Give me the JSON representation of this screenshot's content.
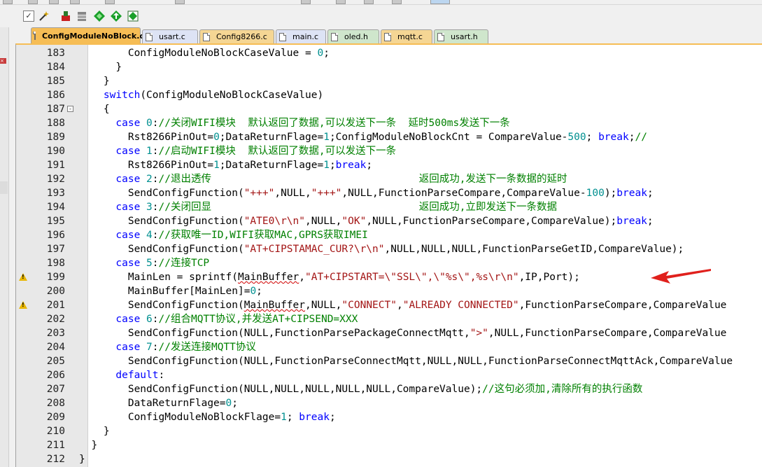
{
  "tabs": [
    {
      "label": "ConfigModuleNoBlock.c",
      "kind": "c",
      "active": true
    },
    {
      "label": "usart.c",
      "kind": "c2",
      "active": false
    },
    {
      "label": "Config8266.c",
      "kind": "c",
      "active": false
    },
    {
      "label": "main.c",
      "kind": "c2",
      "active": false
    },
    {
      "label": "oled.h",
      "kind": "h",
      "active": false
    },
    {
      "label": "mqtt.c",
      "kind": "c",
      "active": false
    },
    {
      "label": "usart.h",
      "kind": "h",
      "active": false
    }
  ],
  "editor": {
    "lines": [
      {
        "num": "183",
        "fold": "",
        "warn": false,
        "segs": [
          [
            "",
            "        ConfigModuleNoBlockCaseValue = "
          ],
          [
            "num",
            "0"
          ],
          [
            "",
            ";"
          ]
        ]
      },
      {
        "num": "184",
        "fold": "",
        "warn": false,
        "segs": [
          [
            "",
            "      }"
          ]
        ]
      },
      {
        "num": "185",
        "fold": "",
        "warn": false,
        "segs": [
          [
            "",
            "    }"
          ]
        ]
      },
      {
        "num": "186",
        "fold": "",
        "warn": false,
        "segs": [
          [
            "",
            "    "
          ],
          [
            "kw",
            "switch"
          ],
          [
            "",
            "(ConfigModuleNoBlockCaseValue)"
          ]
        ]
      },
      {
        "num": "187",
        "fold": "-",
        "warn": false,
        "segs": [
          [
            "",
            "    {"
          ]
        ]
      },
      {
        "num": "188",
        "fold": "",
        "warn": false,
        "segs": [
          [
            "",
            "      "
          ],
          [
            "kw",
            "case"
          ],
          [
            "",
            " "
          ],
          [
            "num",
            "0"
          ],
          [
            "",
            ":"
          ],
          [
            "cm",
            "//关闭WIFI模块  默认返回了数据,可以发送下一条  延时500ms发送下一条"
          ]
        ]
      },
      {
        "num": "189",
        "fold": "",
        "warn": false,
        "segs": [
          [
            "",
            "        Rst8266PinOut="
          ],
          [
            "num",
            "0"
          ],
          [
            "",
            ";DataReturnFlage="
          ],
          [
            "num",
            "1"
          ],
          [
            "",
            ";ConfigModuleNoBlockCnt = CompareValue-"
          ],
          [
            "num",
            "500"
          ],
          [
            "",
            "; "
          ],
          [
            "kw",
            "break"
          ],
          [
            "",
            ";"
          ],
          [
            "cm",
            "//"
          ]
        ]
      },
      {
        "num": "190",
        "fold": "",
        "warn": false,
        "segs": [
          [
            "",
            "      "
          ],
          [
            "kw",
            "case"
          ],
          [
            "",
            " "
          ],
          [
            "num",
            "1"
          ],
          [
            "",
            ":"
          ],
          [
            "cm",
            "//启动WIFI模块  默认返回了数据,可以发送下一条"
          ]
        ]
      },
      {
        "num": "191",
        "fold": "",
        "warn": false,
        "segs": [
          [
            "",
            "        Rst8266PinOut="
          ],
          [
            "num",
            "1"
          ],
          [
            "",
            ";DataReturnFlage="
          ],
          [
            "num",
            "1"
          ],
          [
            "",
            ";"
          ],
          [
            "kw",
            "break"
          ],
          [
            "",
            ";"
          ]
        ]
      },
      {
        "num": "192",
        "fold": "",
        "warn": false,
        "segs": [
          [
            "",
            "      "
          ],
          [
            "kw",
            "case"
          ],
          [
            "",
            " "
          ],
          [
            "num",
            "2"
          ],
          [
            "",
            ":"
          ],
          [
            "cm",
            "//退出透传                                  返回成功,发送下一条数据的延时"
          ]
        ]
      },
      {
        "num": "193",
        "fold": "",
        "warn": false,
        "segs": [
          [
            "",
            "        SendConfigFunction("
          ],
          [
            "str",
            "\"+++\""
          ],
          [
            "",
            ",NULL,"
          ],
          [
            "str",
            "\"+++\""
          ],
          [
            "",
            ",NULL,FunctionParseCompare,CompareValue-"
          ],
          [
            "num",
            "100"
          ],
          [
            "",
            ");"
          ],
          [
            "kw",
            "break"
          ],
          [
            "",
            ";"
          ]
        ]
      },
      {
        "num": "194",
        "fold": "",
        "warn": false,
        "segs": [
          [
            "",
            "      "
          ],
          [
            "kw",
            "case"
          ],
          [
            "",
            " "
          ],
          [
            "num",
            "3"
          ],
          [
            "",
            ":"
          ],
          [
            "cm",
            "//关闭回显                                  返回成功,立即发送下一条数据"
          ]
        ]
      },
      {
        "num": "195",
        "fold": "",
        "warn": false,
        "segs": [
          [
            "",
            "        SendConfigFunction("
          ],
          [
            "str",
            "\"ATE0\\r\\n\""
          ],
          [
            "",
            ",NULL,"
          ],
          [
            "str",
            "\"OK\""
          ],
          [
            "",
            ",NULL,FunctionParseCompare,CompareValue);"
          ],
          [
            "kw",
            "break"
          ],
          [
            "",
            ";"
          ]
        ]
      },
      {
        "num": "196",
        "fold": "",
        "warn": false,
        "segs": [
          [
            "",
            "      "
          ],
          [
            "kw",
            "case"
          ],
          [
            "",
            " "
          ],
          [
            "num",
            "4"
          ],
          [
            "",
            ":"
          ],
          [
            "cm",
            "//获取唯一ID,WIFI获取MAC,GPRS获取IMEI"
          ]
        ]
      },
      {
        "num": "197",
        "fold": "",
        "warn": false,
        "segs": [
          [
            "",
            "        SendConfigFunction("
          ],
          [
            "str",
            "\"AT+CIPSTAMAC_CUR?\\r\\n\""
          ],
          [
            "",
            ",NULL,NULL,NULL,FunctionParseGetID,CompareValue);"
          ]
        ]
      },
      {
        "num": "198",
        "fold": "",
        "warn": false,
        "segs": [
          [
            "",
            "      "
          ],
          [
            "kw",
            "case"
          ],
          [
            "",
            " "
          ],
          [
            "num",
            "5"
          ],
          [
            "",
            ":"
          ],
          [
            "cm",
            "//连接TCP"
          ]
        ]
      },
      {
        "num": "199",
        "fold": "",
        "warn": true,
        "segs": [
          [
            "",
            "        MainLen = sprintf("
          ],
          [
            "squig",
            "MainBuffer"
          ],
          [
            "",
            ","
          ],
          [
            "str",
            "\"AT+CIPSTART=\\\"SSL\\\",\\\"%s\\\",%s\\r\\n\""
          ],
          [
            "",
            ",IP,Port);"
          ]
        ]
      },
      {
        "num": "200",
        "fold": "",
        "warn": false,
        "segs": [
          [
            "",
            "        MainBuffer[MainLen]="
          ],
          [
            "num",
            "0"
          ],
          [
            "",
            ";"
          ]
        ]
      },
      {
        "num": "201",
        "fold": "",
        "warn": true,
        "segs": [
          [
            "",
            "        SendConfigFunction("
          ],
          [
            "squig",
            "MainBuffer"
          ],
          [
            "",
            ",NULL,"
          ],
          [
            "str",
            "\"CONNECT\""
          ],
          [
            "",
            ","
          ],
          [
            "str",
            "\"ALREADY CONNECTED\""
          ],
          [
            "",
            ",FunctionParseCompare,CompareValue"
          ]
        ]
      },
      {
        "num": "202",
        "fold": "",
        "warn": false,
        "segs": [
          [
            "",
            "      "
          ],
          [
            "kw",
            "case"
          ],
          [
            "",
            " "
          ],
          [
            "num",
            "6"
          ],
          [
            "",
            ":"
          ],
          [
            "cm",
            "//组合MQTT协议,并发送AT+CIPSEND=XXX"
          ]
        ]
      },
      {
        "num": "203",
        "fold": "",
        "warn": false,
        "segs": [
          [
            "",
            "        SendConfigFunction(NULL,FunctionParsePackageConnectMqtt,"
          ],
          [
            "str",
            "\">\""
          ],
          [
            "",
            ",NULL,FunctionParseCompare,CompareValue"
          ]
        ]
      },
      {
        "num": "204",
        "fold": "",
        "warn": false,
        "segs": [
          [
            "",
            "      "
          ],
          [
            "kw",
            "case"
          ],
          [
            "",
            " "
          ],
          [
            "num",
            "7"
          ],
          [
            "",
            ":"
          ],
          [
            "cm",
            "//发送连接MQTT协议"
          ]
        ]
      },
      {
        "num": "205",
        "fold": "",
        "warn": false,
        "segs": [
          [
            "",
            "        SendConfigFunction(NULL,FunctionParseConnectMqtt,NULL,NULL,FunctionParseConnectMqttAck,CompareValue"
          ]
        ]
      },
      {
        "num": "206",
        "fold": "",
        "warn": false,
        "segs": [
          [
            "",
            "      "
          ],
          [
            "kw",
            "default"
          ],
          [
            "",
            ":"
          ]
        ]
      },
      {
        "num": "207",
        "fold": "",
        "warn": false,
        "segs": [
          [
            "",
            "        SendConfigFunction(NULL,NULL,NULL,NULL,NULL,CompareValue);"
          ],
          [
            "cm",
            "//这句必须加,清除所有的执行函数"
          ]
        ]
      },
      {
        "num": "208",
        "fold": "",
        "warn": false,
        "segs": [
          [
            "",
            "        DataReturnFlage="
          ],
          [
            "num",
            "0"
          ],
          [
            "",
            ";"
          ]
        ]
      },
      {
        "num": "209",
        "fold": "",
        "warn": false,
        "segs": [
          [
            "",
            "        ConfigModuleNoBlockFlage="
          ],
          [
            "num",
            "1"
          ],
          [
            "",
            "; "
          ],
          [
            "kw",
            "break"
          ],
          [
            "",
            ";"
          ]
        ]
      },
      {
        "num": "210",
        "fold": "",
        "warn": false,
        "segs": [
          [
            "",
            "    }"
          ]
        ]
      },
      {
        "num": "211",
        "fold": "",
        "warn": false,
        "segs": [
          [
            "",
            "  }"
          ]
        ]
      },
      {
        "num": "212",
        "fold": "",
        "warn": false,
        "segs": [
          [
            "",
            "}"
          ]
        ]
      }
    ]
  },
  "toolbar": {
    "icons": [
      "checkbox-icon",
      "wand-icon",
      "build-red-icon",
      "stack-icon",
      "diamond-icon",
      "arrow-diamond-icon",
      "grid-icon"
    ]
  },
  "colors": {
    "keyword": "#0000ff",
    "string": "#a31515",
    "number": "#009090",
    "comment": "#008000",
    "arrow": "#e0201c",
    "active_tab": "#f6bd55"
  }
}
